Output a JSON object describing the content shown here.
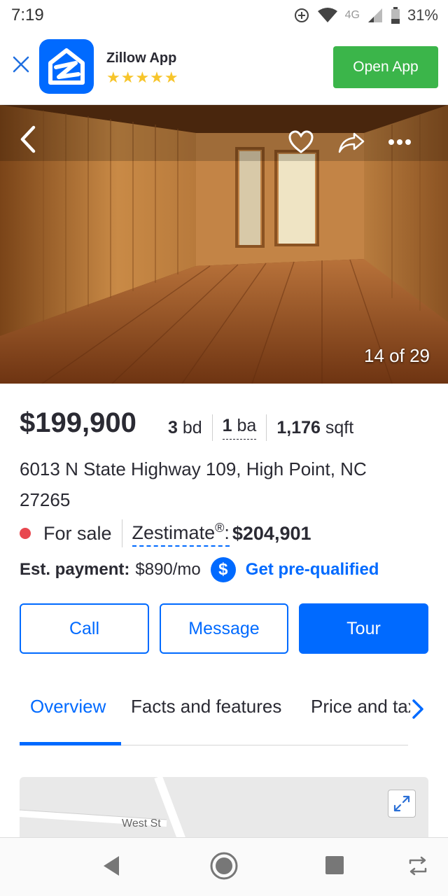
{
  "status_bar": {
    "time": "7:19",
    "network": "4G",
    "battery": "31%"
  },
  "app_banner": {
    "app_name": "Zillow App",
    "rating_stars": "★★★★★",
    "open_label": "Open App"
  },
  "photo": {
    "counter": "14 of 29"
  },
  "listing": {
    "price": "$199,900",
    "beds_value": "3",
    "beds_unit": "bd",
    "baths_value": "1",
    "baths_unit": "ba",
    "sqft_value": "1,176",
    "sqft_unit": "sqft",
    "address_line1": "6013 N State Highway 109, High Point, NC",
    "address_line2": "27265",
    "status": "For sale",
    "zestimate_label": "Zestimate",
    "zestimate_mark": "®",
    "zestimate_colon": ":",
    "zestimate_value": "$204,901",
    "payment_label": "Est. payment:",
    "payment_value": "$890/mo",
    "dollar_icon": "$",
    "prequal_label": "Get pre-qualified"
  },
  "actions": {
    "call": "Call",
    "message": "Message",
    "tour": "Tour"
  },
  "tabs": {
    "overview": "Overview",
    "facts": "Facts and features",
    "price_tax": "Price and tax history"
  },
  "map": {
    "street": "West St"
  },
  "colors": {
    "accent": "#006aff",
    "open_app": "#3bb54a",
    "sale_dot": "#e8474f",
    "stars": "#f7c52b"
  }
}
